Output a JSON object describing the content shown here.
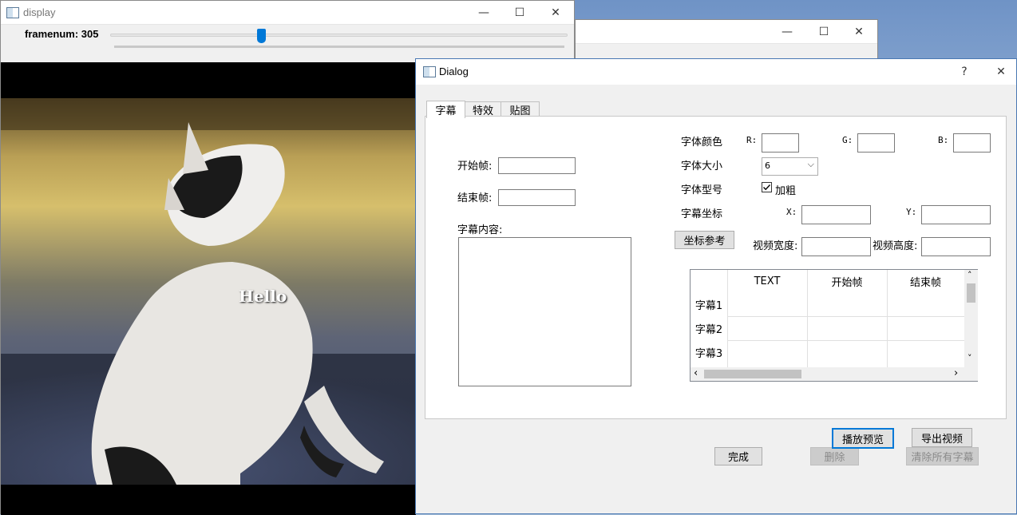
{
  "display_window": {
    "title": "display",
    "frame_label": "framenum: 305",
    "slider_fraction": 0.33,
    "subtitle_text": "Hello"
  },
  "dialog": {
    "title": "Dialog",
    "help_glyph": "?",
    "close_glyph": "✕",
    "tabs": [
      "字幕",
      "特效",
      "贴图"
    ],
    "active_tab": "字幕",
    "left": {
      "start_label": "开始帧:",
      "start_value": "",
      "end_label": "结束帧:",
      "end_value": "",
      "content_label": "字幕内容:",
      "content_value": ""
    },
    "right": {
      "font_color_label": "字体颜色",
      "r_label": "R:",
      "r_value": "",
      "g_label": "G:",
      "g_value": "",
      "b_label": "B:",
      "b_value": "",
      "font_size_label": "字体大小",
      "font_size_value": "6",
      "font_style_label": "字体型号",
      "bold_label": "加粗",
      "bold_checked": true,
      "coord_label": "字幕坐标",
      "x_label": "X:",
      "x_value": "",
      "y_label": "Y:",
      "y_value": "",
      "coord_ref_button": "坐标参考",
      "video_width_label": "视频宽度:",
      "video_width_value": "",
      "video_height_label": "视频高度:",
      "video_height_value": ""
    },
    "table": {
      "columns": [
        "TEXT",
        "开始帧",
        "结束帧"
      ],
      "rows": [
        "字幕1",
        "字幕2",
        "字幕3"
      ]
    },
    "buttons": {
      "done": "完成",
      "delete": "删除",
      "clear_all": "清除所有字幕",
      "play_preview": "播放预览",
      "export_video": "导出视频"
    }
  },
  "icons": {
    "minimize": "—",
    "maximize": "☐",
    "close": "✕",
    "chevron_down": "⌵",
    "scroll_up": "˄",
    "scroll_down": "˅",
    "scroll_left": "‹",
    "scroll_right": "›"
  }
}
